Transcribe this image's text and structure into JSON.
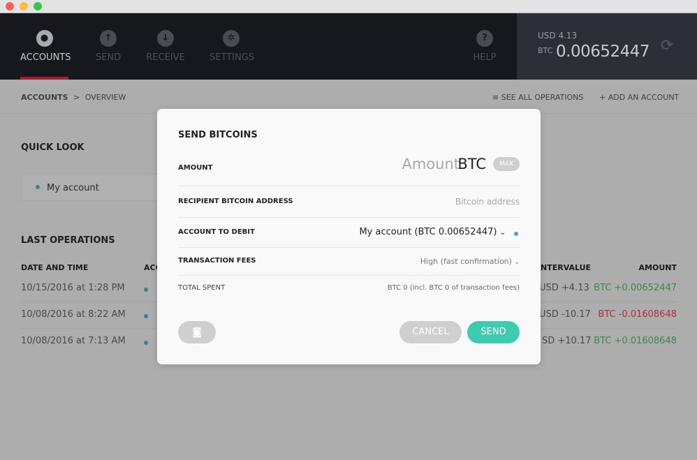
{
  "window": {
    "controls": [
      "close",
      "minimize",
      "maximize"
    ]
  },
  "nav": {
    "items": [
      {
        "label": "ACCOUNTS",
        "icon": "accounts-icon",
        "active": true
      },
      {
        "label": "SEND",
        "icon": "arrow-up-icon"
      },
      {
        "label": "RECEIVE",
        "icon": "arrow-down-icon"
      },
      {
        "label": "SETTINGS",
        "icon": "gear-icon"
      }
    ],
    "help": "HELP"
  },
  "balance": {
    "usd_label": "USD 4.13",
    "btc_label": "BTC",
    "btc_value": "0.00652447"
  },
  "breadcrumb": {
    "root": "ACCOUNTS",
    "sep": ">",
    "current": "OVERVIEW",
    "see_all": "SEE ALL OPERATIONS",
    "add_account": "ADD AN ACCOUNT"
  },
  "quick_look": {
    "title": "QUICK LOOK",
    "account": "My account"
  },
  "operations": {
    "title": "LAST OPERATIONS",
    "headers": [
      "DATE AND TIME",
      "ACC",
      "NTERVALUE",
      "AMOUNT"
    ],
    "rows": [
      {
        "date": "10/15/2016 at 1:28 PM",
        "counter": "USD +4.13",
        "amount": "BTC +0.00652447",
        "positive": true
      },
      {
        "date": "10/08/2016 at 8:22 AM",
        "counter": "USD -10.17",
        "amount": "BTC -0.01608648",
        "positive": false
      },
      {
        "date": "10/08/2016 at 7:13 AM",
        "counter": "SD +10.17",
        "amount": "BTC +0.01608648",
        "positive": true
      }
    ]
  },
  "modal": {
    "title": "SEND BITCOINS",
    "amount_label": "AMOUNT",
    "amount_placeholder": "Amount",
    "amount_unit": "BTC",
    "max": "MAX",
    "recipient_label": "RECIPIENT BITCOIN ADDRESS",
    "recipient_placeholder": "Bitcoin address",
    "debit_label": "ACCOUNT TO DEBIT",
    "debit_value": "My account (BTC 0.00652447)",
    "fees_label": "TRANSACTION FEES",
    "fees_value": "High (fast confirmation)",
    "total_label": "TOTAL SPENT",
    "total_value": "BTC 0 (incl. BTC 0 of transaction fees)",
    "cancel": "CANCEL",
    "send": "SEND"
  },
  "colors": {
    "accent": "#3fcbb0",
    "positive": "#3a8a4a",
    "negative": "#b03040",
    "nav_active": "#a3202e"
  }
}
